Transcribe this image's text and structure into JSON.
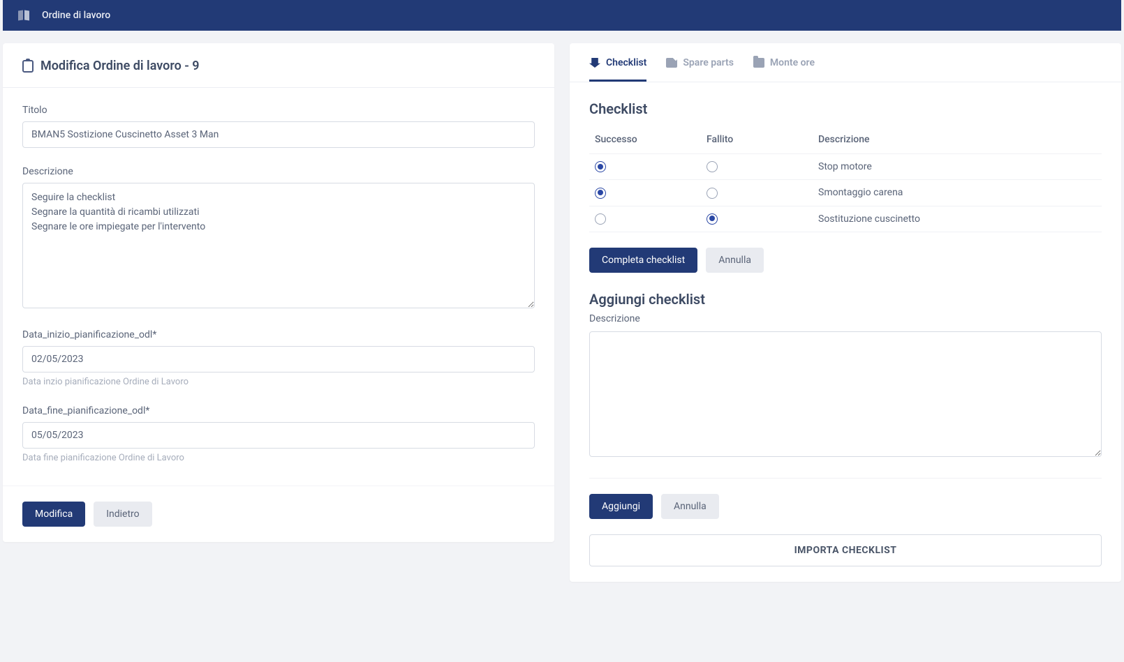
{
  "topbar": {
    "title": "Ordine di lavoro"
  },
  "leftPanel": {
    "heading": "Modifica Ordine di lavoro - 9",
    "fields": {
      "titolo": {
        "label": "Titolo",
        "value": "BMAN5 Sostizione Cuscinetto Asset 3 Man"
      },
      "descrizione": {
        "label": "Descrizione",
        "value": "Seguire la checklist\nSegnare la quantità di ricambi utilizzati\nSegnare le ore impiegate per l'intervento"
      },
      "dataInizio": {
        "label": "Data_inizio_pianificazione_odl*",
        "value": "02/05/2023",
        "help": "Data inzio pianificazione Ordine di Lavoro"
      },
      "dataFine": {
        "label": "Data_fine_pianificazione_odl*",
        "value": "05/05/2023",
        "help": "Data fine pianificazione Ordine di Lavoro"
      }
    },
    "buttons": {
      "modifica": "Modifica",
      "indietro": "Indietro"
    }
  },
  "tabs": [
    {
      "label": "Checklist",
      "active": true
    },
    {
      "label": "Spare parts",
      "active": false
    },
    {
      "label": "Monte ore",
      "active": false
    }
  ],
  "checklist": {
    "heading": "Checklist",
    "columns": {
      "successo": "Successo",
      "fallito": "Fallito",
      "descrizione": "Descrizione"
    },
    "rows": [
      {
        "successo": true,
        "fallito": false,
        "descrizione": "Stop motore"
      },
      {
        "successo": true,
        "fallito": false,
        "descrizione": "Smontaggio carena"
      },
      {
        "successo": false,
        "fallito": true,
        "descrizione": "Sostituzione cuscinetto"
      }
    ],
    "buttons": {
      "completa": "Completa checklist",
      "annulla": "Annulla"
    }
  },
  "addChecklist": {
    "heading": "Aggiungi checklist",
    "descLabel": "Descrizione",
    "descValue": "",
    "buttons": {
      "aggiungi": "Aggiungi",
      "annulla": "Annulla"
    }
  },
  "import": {
    "label": "IMPORTA CHECKLIST"
  }
}
